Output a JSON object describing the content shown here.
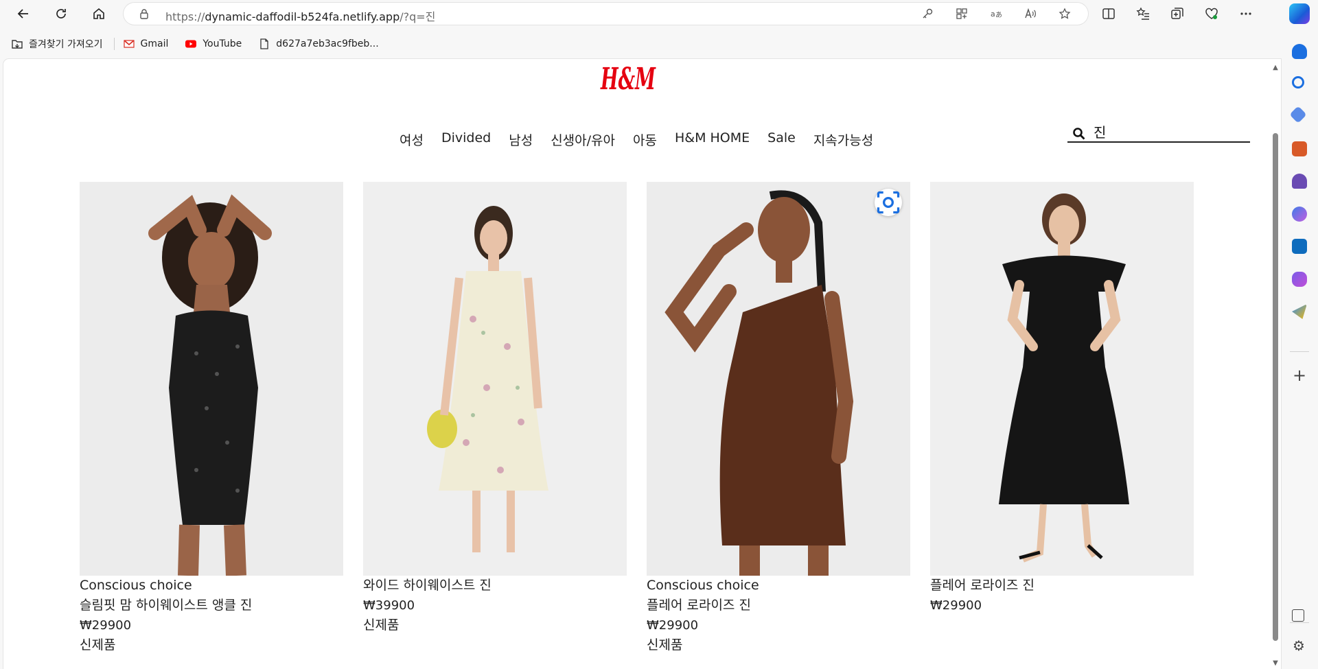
{
  "browser": {
    "url_scheme": "https://",
    "url_host": "dynamic-daffodil-b524fa.netlify.app",
    "url_rest": "/?q=진",
    "bookmarks": [
      {
        "label": "즐겨찾기 가져오기",
        "icon": "import-favorites-icon"
      },
      {
        "label": "Gmail",
        "icon": "gmail-icon"
      },
      {
        "label": "YouTube",
        "icon": "youtube-icon"
      },
      {
        "label": "d627a7eb3ac9fbeb...",
        "icon": "document-icon"
      }
    ]
  },
  "site": {
    "brand": "H&M",
    "brand_color": "#e50010",
    "nav": [
      "여성",
      "Divided",
      "남성",
      "신생아/유아",
      "아동",
      "H&M HOME",
      "Sale",
      "지속가능성"
    ],
    "search": {
      "value": "진"
    }
  },
  "products": [
    {
      "tag": "Conscious choice",
      "name": "슬림핏 맘 하이웨이스트 앵클 진",
      "price": "₩29900",
      "badge": "신제품"
    },
    {
      "tag": "",
      "name": "와이드 하이웨이스트 진",
      "price": "₩39900",
      "badge": "신제품"
    },
    {
      "tag": "Conscious choice",
      "name": "플레어 로라이즈 진",
      "price": "₩29900",
      "badge": "신제품"
    },
    {
      "tag": "",
      "name": "플레어 로라이즈 진",
      "price": "₩29900",
      "badge": ""
    }
  ]
}
